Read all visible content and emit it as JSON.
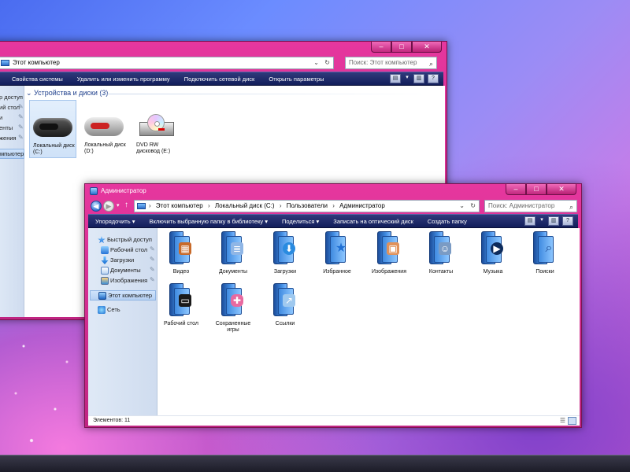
{
  "back_window": {
    "address": {
      "segments": [
        "Этот компьютер"
      ]
    },
    "search": {
      "placeholder": "Поиск: Этот компьютер"
    },
    "commands": [
      "Свойства системы",
      "Удалить или изменить программу",
      "Подключить сетевой диск",
      "Открыть параметры"
    ],
    "nav_items": [
      {
        "label": "р доступ",
        "icon": "star-icon"
      },
      {
        "label": "ий стол",
        "icon": "desktop-icon"
      },
      {
        "label": "и",
        "icon": "downloads-icon"
      },
      {
        "label": "енты",
        "icon": "documents-icon"
      },
      {
        "label": "жения",
        "icon": "pictures-icon"
      },
      {
        "label": "мпьютер",
        "icon": "computer-icon"
      }
    ],
    "section_title": "Устройства и диски (3)",
    "drives": [
      {
        "label1": "Локальный диск",
        "label2": "(C:)",
        "icon": "hdd-icon"
      },
      {
        "label1": "Локальный диск",
        "label2": "(D:)",
        "icon": "hdd-icon"
      },
      {
        "label1": "DVD RW",
        "label2": "дисковод (E:)",
        "icon": "dvd-drive-icon"
      }
    ]
  },
  "front_window": {
    "title": "Администратор",
    "address": {
      "segments": [
        "Этот компьютер",
        "Локальный диск (C:)",
        "Пользователи",
        "Администратор"
      ]
    },
    "search": {
      "placeholder": "Поиск: Администратор"
    },
    "commands": [
      "Упорядочить ▾",
      "Включить выбранную папку в библиотеку ▾",
      "Поделиться ▾",
      "Записать на оптический диск",
      "Создать папку"
    ],
    "nav": {
      "quick_access": "Быстрый доступ",
      "items": [
        {
          "label": "Рабочий стол",
          "icon": "desktop-icon"
        },
        {
          "label": "Загрузки",
          "icon": "downloads-icon"
        },
        {
          "label": "Документы",
          "icon": "documents-icon"
        },
        {
          "label": "Изображения",
          "icon": "pictures-icon"
        }
      ],
      "this_pc": "Этот компьютер",
      "network": "Сеть"
    },
    "folders": [
      {
        "label": "Видео",
        "icon": "video-folder-icon",
        "glyph": "▦"
      },
      {
        "label": "Документы",
        "icon": "documents-folder-icon",
        "glyph": "≣"
      },
      {
        "label": "Загрузки",
        "icon": "downloads-folder-icon",
        "glyph": "⬇"
      },
      {
        "label": "Избранное",
        "icon": "favorites-folder-icon",
        "glyph": "★"
      },
      {
        "label": "Изображения",
        "icon": "pictures-folder-icon",
        "glyph": "▣"
      },
      {
        "label": "Контакты",
        "icon": "contacts-folder-icon",
        "glyph": "☺"
      },
      {
        "label": "Музыка",
        "icon": "music-folder-icon",
        "glyph": "▶"
      },
      {
        "label": "Поиски",
        "icon": "searches-folder-icon",
        "glyph": "⌕"
      },
      {
        "label": "Рабочий стол",
        "icon": "desktop-folder-icon",
        "glyph": "▭"
      },
      {
        "label": "Сохраненные игры",
        "icon": "saved-games-folder-icon",
        "glyph": "✚"
      },
      {
        "label": "Ссылки",
        "icon": "links-folder-icon",
        "glyph": "↗"
      }
    ],
    "status": "Элементов: 11"
  },
  "colors": {
    "window_frame": "#d42e90",
    "command_bar": "#1f2b6a",
    "nav_pane": "#d5e1f2",
    "accent_blue": "#2a6fcf"
  }
}
